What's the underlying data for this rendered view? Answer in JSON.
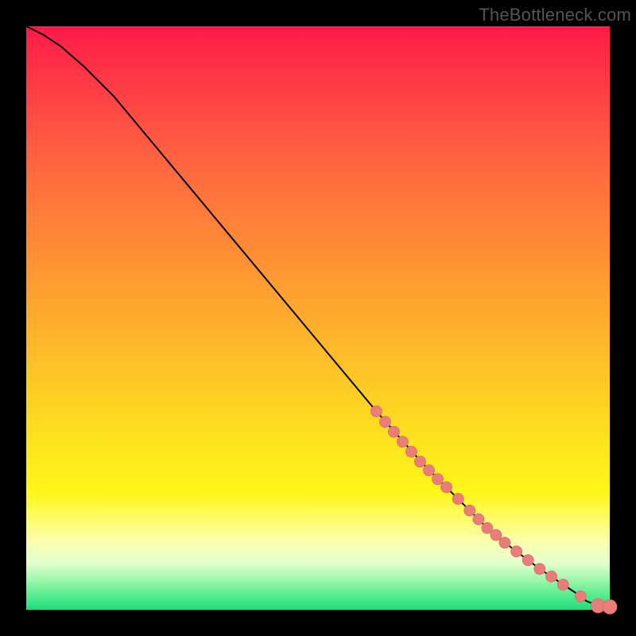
{
  "watermark": "TheBottleneck.com",
  "colors": {
    "marker": "#e97d7a",
    "marker_stroke": "#d86c6a",
    "curve": "#000000",
    "frame": "#000000",
    "gradient": [
      "#ff1a47",
      "#ff3b46",
      "#ff6a3f",
      "#ff9133",
      "#fdb92a",
      "#fde01e",
      "#fff61a",
      "#fbffa9",
      "#e4ffcf",
      "#7df39e",
      "#19e07a"
    ]
  },
  "chart_data": {
    "type": "line",
    "title": "",
    "xlabel": "",
    "ylabel": "",
    "xlim": [
      0,
      100
    ],
    "ylim": [
      0,
      100
    ],
    "grid": false,
    "series": [
      {
        "name": "curve",
        "x": [
          0,
          3,
          6,
          10,
          15,
          20,
          30,
          40,
          50,
          60,
          68,
          72,
          76,
          80,
          84,
          88,
          91,
          94,
          96,
          98,
          100
        ],
        "y": [
          100,
          98.5,
          96.5,
          93,
          88,
          82,
          70,
          58,
          46,
          34,
          25,
          21,
          17,
          13,
          10,
          7,
          5,
          3,
          1.5,
          0.7,
          0.5
        ]
      }
    ],
    "markers": {
      "name": "highlighted-points",
      "x": [
        60,
        61.5,
        63,
        64.5,
        66,
        67.5,
        69,
        70.5,
        72,
        74,
        76,
        77.5,
        79,
        80.5,
        82,
        84,
        86,
        88,
        90,
        92,
        95,
        98,
        100
      ],
      "y": [
        34.0,
        32.2,
        30.5,
        28.8,
        27.1,
        25.4,
        23.9,
        22.4,
        21.0,
        19.0,
        17.0,
        15.5,
        14.0,
        12.8,
        11.5,
        10.0,
        8.5,
        7.0,
        5.7,
        4.3,
        2.3,
        0.7,
        0.5
      ],
      "r_default": 7,
      "r_large_indices": [
        21,
        22
      ]
    },
    "tail_segment": {
      "x0": 98,
      "y0": 0.7,
      "x1": 100,
      "y1": 0.5
    }
  }
}
